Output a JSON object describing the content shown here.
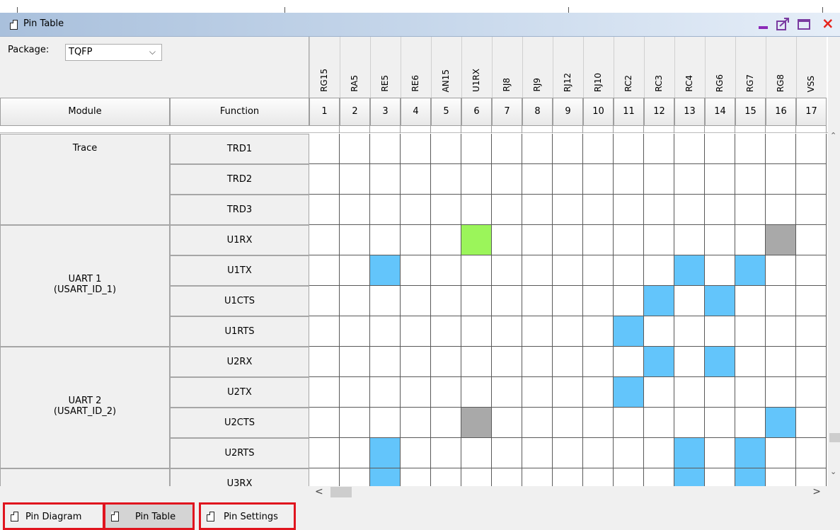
{
  "window": {
    "title": "Pin Table"
  },
  "package": {
    "label": "Package:",
    "value": "TQFP"
  },
  "headers": {
    "module": "Module",
    "function": "Function"
  },
  "pins": [
    {
      "num": "1",
      "name": "RG15"
    },
    {
      "num": "2",
      "name": "RA5"
    },
    {
      "num": "3",
      "name": "RE5"
    },
    {
      "num": "4",
      "name": "RE6"
    },
    {
      "num": "5",
      "name": "AN15"
    },
    {
      "num": "6",
      "name": "U1RX"
    },
    {
      "num": "7",
      "name": "RJ8"
    },
    {
      "num": "8",
      "name": "RJ9"
    },
    {
      "num": "9",
      "name": "RJ12"
    },
    {
      "num": "10",
      "name": "RJ10"
    },
    {
      "num": "11",
      "name": "RC2"
    },
    {
      "num": "12",
      "name": "RC3"
    },
    {
      "num": "13",
      "name": "RC4"
    },
    {
      "num": "14",
      "name": "RG6"
    },
    {
      "num": "15",
      "name": "RG7"
    },
    {
      "num": "16",
      "name": "RG8"
    },
    {
      "num": "17",
      "name": "VSS"
    }
  ],
  "modules": [
    {
      "name": "Trace",
      "sub": "",
      "functions": [
        "TRD1",
        "TRD2",
        "TRD3"
      ]
    },
    {
      "name": "UART 1",
      "sub": "(USART_ID_1)",
      "functions": [
        "U1RX",
        "U1TX",
        "U1CTS",
        "U1RTS"
      ]
    },
    {
      "name": "UART 2",
      "sub": "(USART_ID_2)",
      "functions": [
        "U2RX",
        "U2TX",
        "U2CTS",
        "U2RTS"
      ]
    },
    {
      "name": "",
      "sub": "",
      "functions": [
        "U3RX"
      ]
    }
  ],
  "cell_states": {
    "U1RX": {
      "6": "selected",
      "16": "unavailable"
    },
    "U1TX": {
      "3": "available",
      "13": "available",
      "15": "available"
    },
    "U1CTS": {
      "12": "available",
      "14": "available"
    },
    "U1RTS": {
      "11": "available"
    },
    "U2RX": {
      "12": "available",
      "14": "available"
    },
    "U2TX": {
      "11": "available"
    },
    "U2CTS": {
      "6": "unavailable",
      "16": "available"
    },
    "U2RTS": {
      "3": "available",
      "13": "available",
      "15": "available"
    },
    "U3RX": {
      "3": "available",
      "13": "available",
      "15": "available"
    }
  },
  "colors": {
    "available": "#63c5fb",
    "selected": "#9bf55a",
    "unavailable": "#a9a9a9"
  },
  "tabs": [
    {
      "label": "Pin Diagram",
      "active": false
    },
    {
      "label": "Pin Table",
      "active": true
    },
    {
      "label": "Pin Settings",
      "active": false
    }
  ]
}
